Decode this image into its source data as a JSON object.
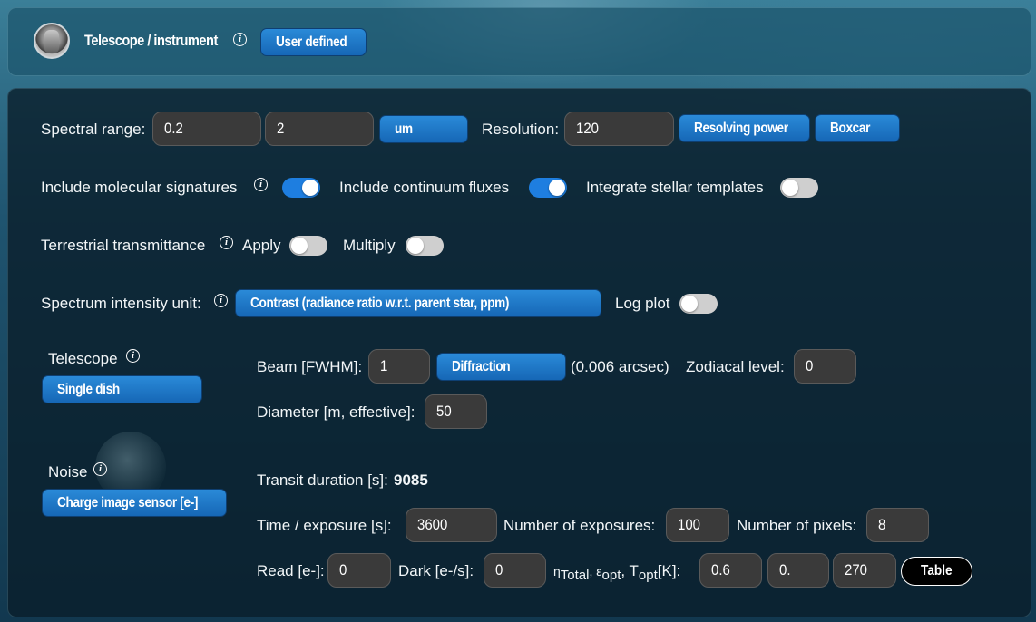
{
  "header": {
    "title": "Telescope / instrument",
    "mode_button": "User defined"
  },
  "spectral": {
    "label": "Spectral range:",
    "min": "0.2",
    "max": "2",
    "unit": "um",
    "resolution_label": "Resolution:",
    "resolution": "120",
    "resolution_type": "Resolving power",
    "kernel": "Boxcar"
  },
  "toggles": {
    "molecular_label": "Include molecular signatures",
    "molecular_on": true,
    "continuum_label": "Include continuum fluxes",
    "continuum_on": true,
    "stellar_label": "Integrate stellar templates",
    "stellar_on": false
  },
  "terrestrial": {
    "label": "Terrestrial transmittance",
    "apply_label": "Apply",
    "apply_on": false,
    "multiply_label": "Multiply",
    "multiply_on": false
  },
  "intensity": {
    "label": "Spectrum intensity unit:",
    "unit": "Contrast (radiance ratio w.r.t. parent star, ppm)",
    "log_label": "Log plot",
    "log_on": false
  },
  "telescope": {
    "label": "Telescope",
    "type": "Single dish",
    "beam_label": "Beam [FWHM]:",
    "beam": "1",
    "beam_mode": "Diffraction",
    "beam_note": "(0.006 arcsec)",
    "zodi_label": "Zodiacal level:",
    "zodi": "0",
    "diameter_label": "Diameter [m, effective]:",
    "diameter": "50"
  },
  "noise": {
    "label": "Noise",
    "type": "Charge image sensor [e-]",
    "transit_label": "Transit duration [s]:",
    "transit_value": "9085",
    "exposure_label": "Time / exposure [s]:",
    "exposure": "3600",
    "n_exposures_label": "Number of exposures:",
    "n_exposures": "100",
    "n_pixels_label": "Number of pixels:",
    "n_pixels": "8",
    "read_label": "Read [e-]:",
    "read": "0",
    "dark_label": "Dark [e-/s]:",
    "dark": "0",
    "eta_prefix": "η",
    "eta_sub": "Total",
    "eps_prefix": ", ε",
    "eps_sub": "opt",
    "t_prefix": ", T",
    "t_sub": "opt",
    "t_suffix": "[K]:",
    "eta_total": "0.6",
    "eps_opt": "0.",
    "t_opt": "270",
    "table_button": "Table"
  },
  "colors": {
    "accent": "#1e7ee0",
    "field_bg": "#3a3a3a"
  }
}
